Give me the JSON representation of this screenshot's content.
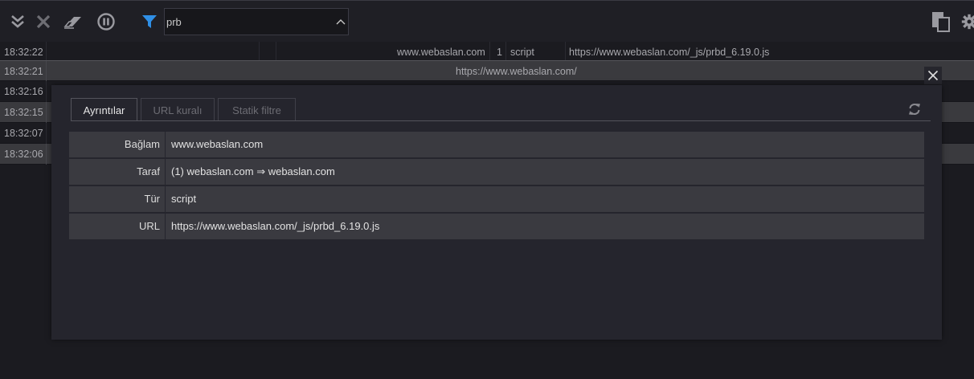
{
  "toolbar": {
    "filter_value": "prb",
    "icons": [
      "collapse-all-icon",
      "clear-icon",
      "eraser-icon",
      "pause-icon",
      "filter-icon",
      "chevron-up-icon",
      "copy-icon",
      "gear-icon"
    ],
    "filter_color": "#2f8fe6"
  },
  "log": {
    "rows": [
      {
        "time": "18:32:22",
        "domain": "www.webaslan.com",
        "party": "1",
        "type": "script",
        "url": "https://www.webaslan.com/_js/prbd_6.19.0.js"
      },
      {
        "time": "18:32:21",
        "center_url": "https://www.webaslan.com/"
      },
      {
        "time": "18:32:16"
      },
      {
        "time": "18:32:15"
      },
      {
        "time": "18:32:07"
      },
      {
        "time": "18:32:06"
      }
    ]
  },
  "modal": {
    "tabs": [
      {
        "label": "Ayrıntılar",
        "active": true
      },
      {
        "label": "URL kuralı",
        "active": false
      },
      {
        "label": "Statik filtre",
        "active": false
      }
    ],
    "details": [
      {
        "label": "Bağlam",
        "value": "www.webaslan.com"
      },
      {
        "label": "Taraf",
        "value": "(1)  webaslan.com ⇒ webaslan.com"
      },
      {
        "label": "Tür",
        "value": "script"
      },
      {
        "label": "URL",
        "value": "https://www.webaslan.com/_js/prbd_6.19.0.js"
      }
    ]
  }
}
